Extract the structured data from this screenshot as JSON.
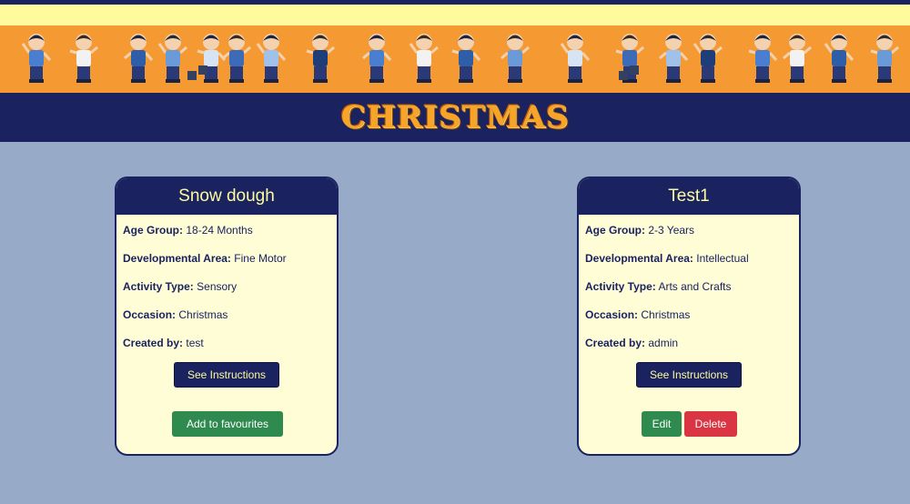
{
  "header": {
    "title": "Christmas"
  },
  "colors": {
    "navy": "#1a2260",
    "yellow": "#fdfb9c",
    "orange": "#f59a33",
    "background": "#97abc9",
    "card_bg": "#fffdd6",
    "green": "#2e8a4e",
    "red": "#d93542"
  },
  "banner": {
    "icon": "kids-playing-illustration"
  },
  "cards": [
    {
      "title": "Snow dough",
      "age_group_label": "Age Group:",
      "age_group": "18-24 Months",
      "dev_area_label": "Developmental Area:",
      "dev_area": "Fine Motor",
      "activity_type_label": "Activity Type:",
      "activity_type": "Sensory",
      "occasion_label": "Occasion:",
      "occasion": "Christmas",
      "created_by_label": "Created by:",
      "created_by": "test",
      "instructions_button": "See Instructions",
      "favourite_button": "Add to favourites"
    },
    {
      "title": "Test1",
      "age_group_label": "Age Group:",
      "age_group": "2-3 Years",
      "dev_area_label": "Developmental Area:",
      "dev_area": "Intellectual",
      "activity_type_label": "Activity Type:",
      "activity_type": "Arts and Crafts",
      "occasion_label": "Occasion:",
      "occasion": "Christmas",
      "created_by_label": "Created by:",
      "created_by": "admin",
      "instructions_button": "See Instructions",
      "edit_button": "Edit",
      "delete_button": "Delete"
    }
  ]
}
